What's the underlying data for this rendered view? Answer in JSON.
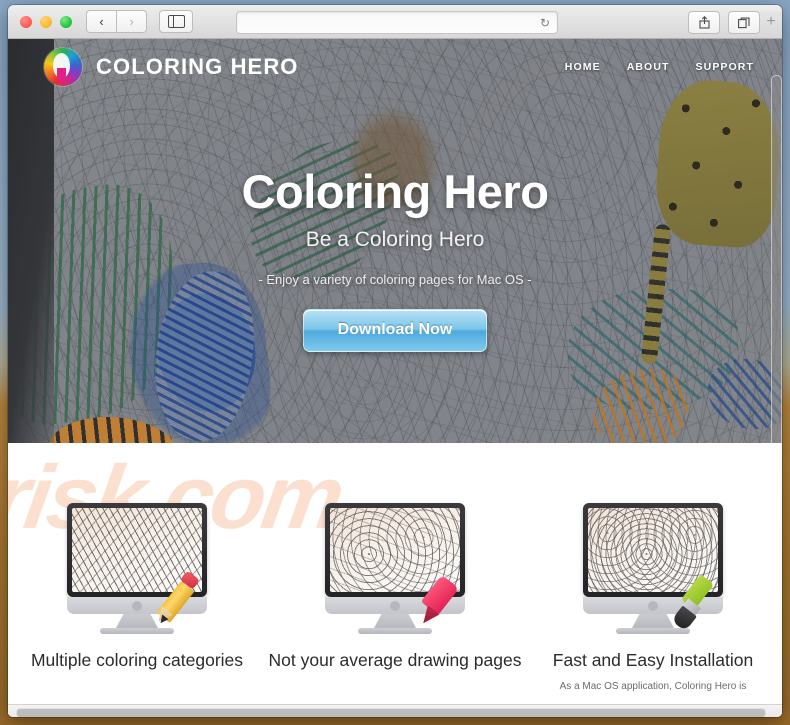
{
  "browser": {
    "traffic_lights": [
      "close",
      "minimize",
      "zoom"
    ],
    "back_label": "‹",
    "forward_label": "›",
    "sidebar_label": "sidebar",
    "url_value": "",
    "url_placeholder": "",
    "reload_label": "↻",
    "share_label": "⇧",
    "tabs_label": "⧉",
    "new_tab_label": "+"
  },
  "site": {
    "logo_text": "COLORING HERO",
    "nav": [
      {
        "label": "HOME"
      },
      {
        "label": "ABOUT"
      },
      {
        "label": "SUPPORT"
      }
    ],
    "hero": {
      "title": "Coloring Hero",
      "subtitle": "Be a Coloring Hero",
      "tagline": "- Enjoy a variety of coloring pages for Mac OS -",
      "cta": "Download Now"
    },
    "watermark": "risk.com",
    "features": [
      {
        "title": "Multiple coloring categories",
        "body": "",
        "tool": "pencil-icon",
        "art": "zebra-coloring-page"
      },
      {
        "title": "Not your average drawing pages",
        "body": "",
        "tool": "marker-icon",
        "art": "peacock-coloring-page"
      },
      {
        "title": "Fast and Easy Installation",
        "body": "As a Mac OS application, Coloring Hero is",
        "tool": "paintbrush-icon",
        "art": "flowers-coloring-page"
      }
    ]
  },
  "colors": {
    "hero_background": "#8e9196",
    "cta_blue": "#7cc6ea",
    "watermark": "#fbdfcf",
    "desktop_top": "#8aa7c6",
    "desktop_bottom": "#9a6b2a"
  }
}
